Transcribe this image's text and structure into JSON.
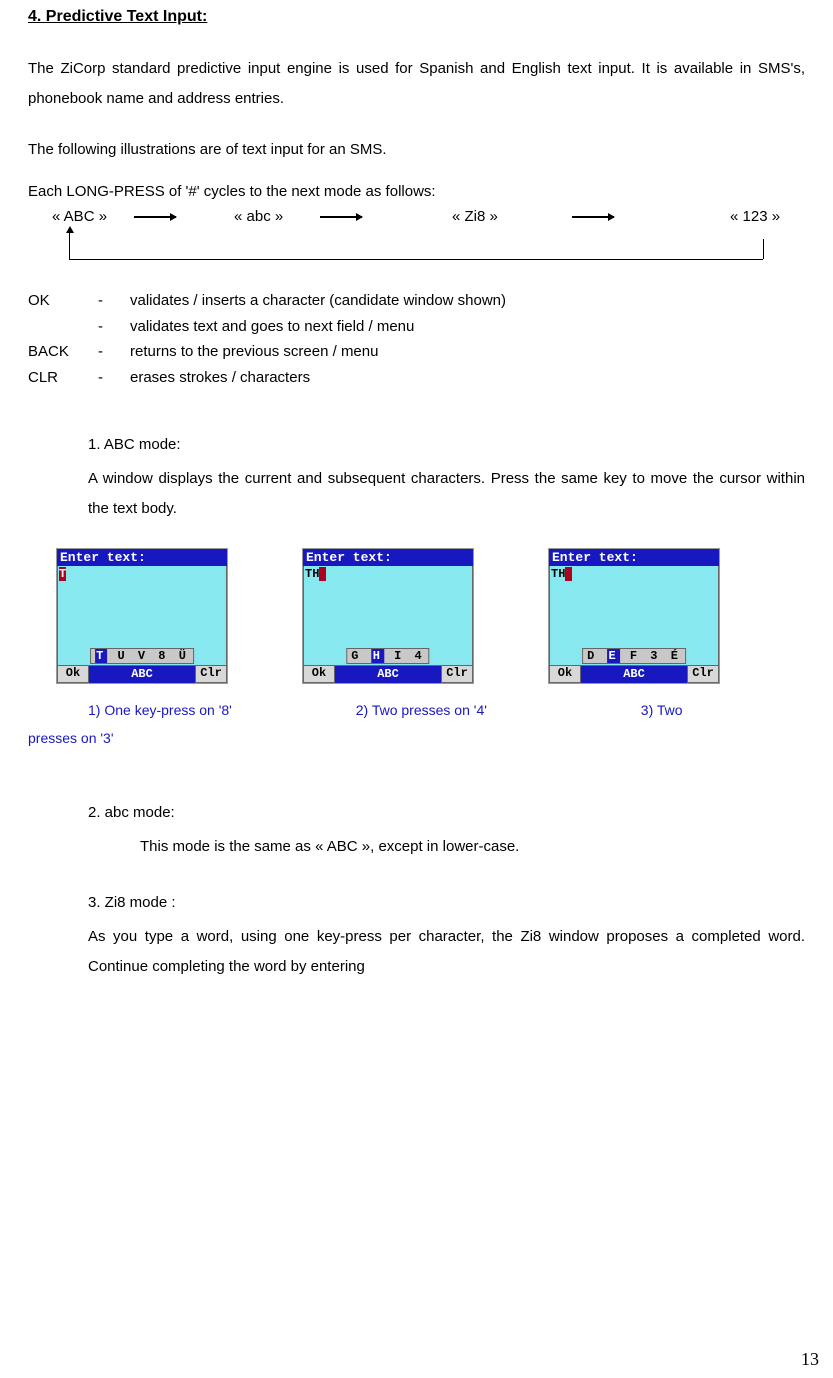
{
  "heading": "4. Predictive Text Input:",
  "para1": "The ZiCorp standard predictive input engine is used for Spanish and English text input. It is available in SMS's, phonebook name and address entries.",
  "para2": "The following illustrations are of text input for an SMS.",
  "para3": "Each LONG-PRESS of '#' cycles to the next mode as follows:",
  "modes": {
    "m1": "« ABC »",
    "m2": "« abc »",
    "m3": "« Zi8 »",
    "m4": "« 123 »"
  },
  "keys": {
    "r1": {
      "k": "OK",
      "d": "-",
      "t": "validates / inserts a character (candidate window shown)"
    },
    "r2": {
      "k": "",
      "d": "-",
      "t": "validates text and goes to next field / menu"
    },
    "r3": {
      "k": "BACK",
      "d": "-",
      "t": "returns to the previous screen / menu"
    },
    "r4": {
      "k": "CLR",
      "d": "-",
      "t": "erases strokes / characters"
    }
  },
  "abc": {
    "title": "1. ABC mode:",
    "text": "A window displays the current and subsequent characters. Press the same key to move the cursor within the text body."
  },
  "screens": {
    "title": "Enter text:",
    "sk_ok": "Ok",
    "sk_mode": "ABC",
    "sk_clr": "Clr",
    "s1": {
      "text": "T",
      "cand_hl": "T",
      "cand_rest": "U V 8 Ü"
    },
    "s2": {
      "text": "TH",
      "cand_pre": "G ",
      "cand_hl": "H",
      "cand_rest": " I 4"
    },
    "s3": {
      "text": "TH",
      "cand_pre": "D ",
      "cand_hl": "E",
      "cand_rest": " F 3 É"
    }
  },
  "captions_line1a": "1) One key-press on '8'",
  "captions_line1b": "2) Two presses on '4'",
  "captions_line1c": "3) Two",
  "captions_line2": "presses on '3'",
  "abc_lower": {
    "title": "2. abc mode:",
    "text": "This mode is the same as « ABC », except in lower-case."
  },
  "zi8": {
    "title": "3. Zi8 mode :",
    "text": "As you type a word, using one key-press per character, the Zi8 window proposes a completed word.  Continue completing the word by entering"
  },
  "page_number": "13"
}
